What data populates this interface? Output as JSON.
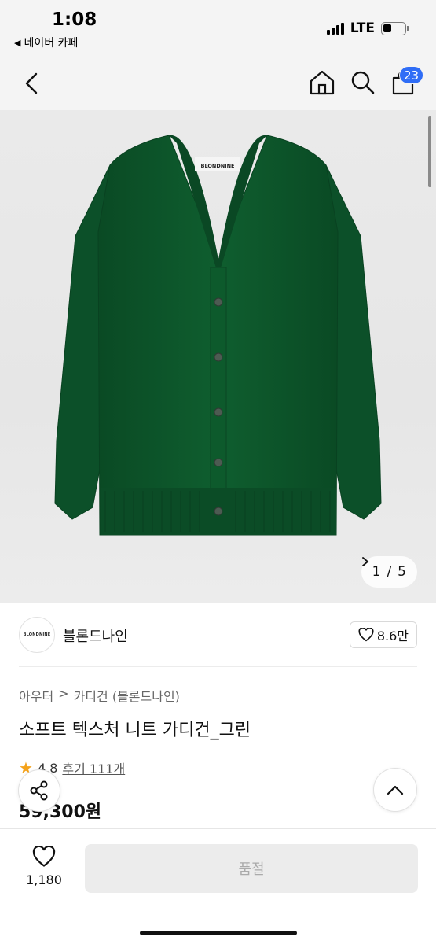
{
  "status": {
    "time": "1:08",
    "back_app": "네이버 카페",
    "network": "LTE"
  },
  "nav": {
    "cart_count": "23"
  },
  "gallery": {
    "brand_tag": "BLONDNINE",
    "current": "1",
    "separator": "/",
    "total": "5",
    "garment_color": "#0d5a2c"
  },
  "brand": {
    "logo_text": "BLONDNINE",
    "name": "블론드나인",
    "likes": "8.6만"
  },
  "product": {
    "category_1": "아우터",
    "category_sep": ">",
    "category_2": "카디건 (블론드나인)",
    "title": "소프트 텍스처 니트 가디건_그린",
    "rating": "4.8",
    "reviews": "후기 111개",
    "price": "59,300원"
  },
  "bottom": {
    "wish_count": "1,180",
    "buy_label": "품절"
  },
  "colors": {
    "accent": "#2f6df6",
    "star": "#f4a21a"
  }
}
